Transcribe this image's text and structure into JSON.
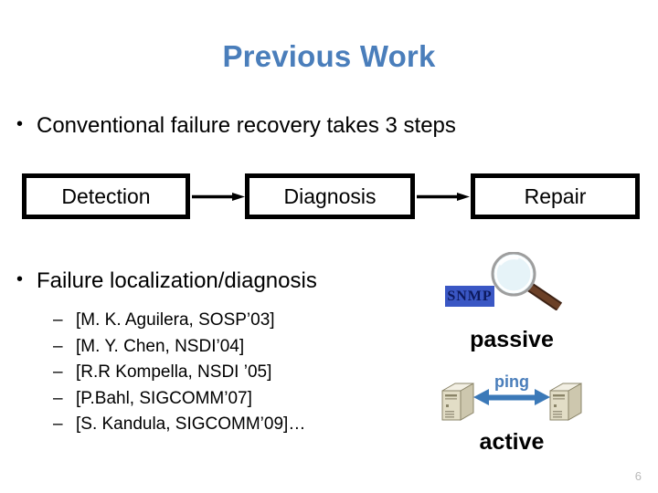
{
  "slide": {
    "title": "Previous Work",
    "page_number": "6",
    "accent_color": "#4a7ebb"
  },
  "bullets": {
    "conventional": {
      "marker": "•",
      "text": "Conventional failure recovery takes 3 steps"
    },
    "failure": {
      "marker": "•",
      "text": "Failure localization/diagnosis"
    }
  },
  "flow": {
    "boxes": [
      {
        "label": "Detection"
      },
      {
        "label": "Diagnosis"
      },
      {
        "label": "Repair"
      }
    ],
    "arrows": [
      {
        "name": "detection-to-diagnosis"
      },
      {
        "name": "diagnosis-to-repair"
      }
    ]
  },
  "citations": {
    "marker": "–",
    "items": [
      "[M. K. Aguilera, SOSP’03]",
      "[M. Y. Chen, NSDI’04]",
      "[R.R Kompella, NSDI ’05]",
      "[P.Bahl, SIGCOMM’07]",
      "[S. Kandula, SIGCOMM’09]…"
    ]
  },
  "graphics": {
    "snmp_badge": {
      "label": "SNMP",
      "background": "#3a57c4",
      "text_color": "#0d1a5e"
    },
    "magnifier": {
      "lens_color": "#e8f4f8",
      "rim_color": "#d9d9d9",
      "handle_color": "#5a3420"
    },
    "passive_label": "passive",
    "ping_label": "ping",
    "active_label": "active",
    "ping_arrow_color": "#3b79b8",
    "server_body_color": "#ddd9c3",
    "server_top_color": "#f2efe3"
  }
}
